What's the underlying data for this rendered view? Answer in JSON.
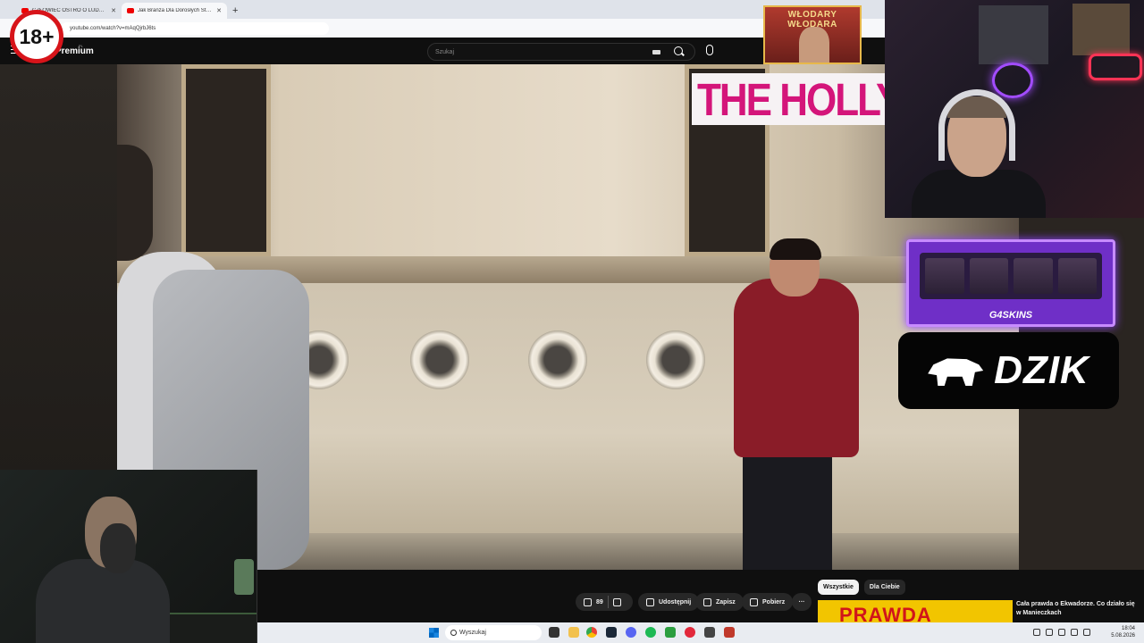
{
  "browser": {
    "tabs": [
      {
        "title": "CZŁOWIEC OSTRO O LUDZIA..."
      },
      {
        "title": "Jak Branża Dla Dorosłych Stała..."
      }
    ],
    "new_tab": "+",
    "url": "youtube.com/watch?v=mAqQjrbJ6ts"
  },
  "youtube": {
    "logo": "Premium",
    "logo_sup": "PL",
    "search_placeholder": "Szukaj"
  },
  "overlays": {
    "age_badge": "18+",
    "top_banner": "WŁODARY WŁODARA",
    "video_sign": "THE HOLLYW",
    "g4skins_label": "G4SKINS",
    "dzik_label": "DZIK"
  },
  "actions": {
    "likes": "89",
    "share": "Udostępnij",
    "save": "Zapisz",
    "download": "Pobierz",
    "more": "···"
  },
  "filters": [
    {
      "label": "Wszystkie"
    },
    {
      "label": "Dla Ciebie"
    }
  ],
  "recommendation": {
    "thumb_text": "PRAWDA",
    "title": "Cała prawda o Ekwadorze. Co działo się w Manieczkach"
  },
  "taskbar": {
    "search_placeholder": "Wyszukaj",
    "time": "18:04",
    "date": "5.08.2026"
  },
  "colors": {
    "accent_red": "#d7141a",
    "g4skins_purple": "#6f2fc7",
    "yt_bg": "#0f0f0f"
  }
}
